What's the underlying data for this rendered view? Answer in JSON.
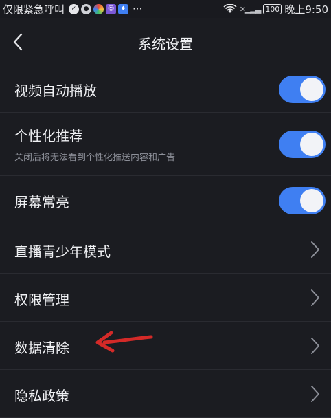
{
  "status_bar": {
    "carrier": "仅限紧急呼叫",
    "time": "晚上9:50",
    "battery": "100",
    "more": "···",
    "icons": [
      "shield-check-icon",
      "app-badge-icon",
      "app-swirl-icon",
      "app-robot-icon",
      "app-bulb-icon"
    ],
    "right_icons": [
      "wifi-icon",
      "sim-signal-icon",
      "battery-icon"
    ]
  },
  "header": {
    "title": "系统设置",
    "back_icon": "chevron-left-icon"
  },
  "settings": [
    {
      "label": "视频自动播放",
      "type": "toggle",
      "on": true
    },
    {
      "label": "个性化推荐",
      "sublabel": "关闭后将无法看到个性化推送内容和广告",
      "type": "toggle",
      "on": true
    },
    {
      "label": "屏幕常亮",
      "type": "toggle",
      "on": true
    },
    {
      "label": "直播青少年模式",
      "type": "link"
    },
    {
      "label": "权限管理",
      "type": "link"
    },
    {
      "label": "数据清除",
      "type": "link"
    },
    {
      "label": "隐私政策",
      "type": "link"
    }
  ],
  "colors": {
    "background": "#1b1c21",
    "toggle_on": "#3f7ff2",
    "annotation_arrow": "#d42a28"
  }
}
